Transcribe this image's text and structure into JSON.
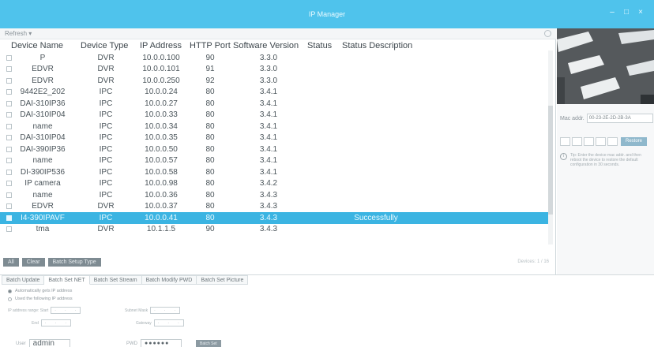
{
  "window": {
    "title": "IP Manager"
  },
  "toolbar": {
    "refresh": "Refresh ▾"
  },
  "table": {
    "headers": [
      "Device Name",
      "Device Type",
      "IP Address",
      "HTTP Port",
      "Software Version",
      "Status",
      "Status Description"
    ],
    "rows": [
      {
        "name": "P",
        "type": "DVR",
        "ip": "10.0.0.100",
        "port": "90",
        "version": "3.3.0",
        "status": "",
        "desc": "",
        "selected": false
      },
      {
        "name": "EDVR",
        "type": "DVR",
        "ip": "10.0.0.101",
        "port": "91",
        "version": "3.3.0",
        "status": "",
        "desc": "",
        "selected": false
      },
      {
        "name": "EDVR",
        "type": "DVR",
        "ip": "10.0.0.250",
        "port": "92",
        "version": "3.3.0",
        "status": "",
        "desc": "",
        "selected": false
      },
      {
        "name": "9442E2_202",
        "type": "IPC",
        "ip": "10.0.0.24",
        "port": "80",
        "version": "3.4.1",
        "status": "",
        "desc": "",
        "selected": false
      },
      {
        "name": "DAI-310IP36",
        "type": "IPC",
        "ip": "10.0.0.27",
        "port": "80",
        "version": "3.4.1",
        "status": "",
        "desc": "",
        "selected": false
      },
      {
        "name": "DAI-310IP04",
        "type": "IPC",
        "ip": "10.0.0.33",
        "port": "80",
        "version": "3.4.1",
        "status": "",
        "desc": "",
        "selected": false
      },
      {
        "name": "name",
        "type": "IPC",
        "ip": "10.0.0.34",
        "port": "80",
        "version": "3.4.1",
        "status": "",
        "desc": "",
        "selected": false
      },
      {
        "name": "DAI-310IP04",
        "type": "IPC",
        "ip": "10.0.0.35",
        "port": "80",
        "version": "3.4.1",
        "status": "",
        "desc": "",
        "selected": false
      },
      {
        "name": "DAI-390IP36",
        "type": "IPC",
        "ip": "10.0.0.50",
        "port": "80",
        "version": "3.4.1",
        "status": "",
        "desc": "",
        "selected": false
      },
      {
        "name": "name",
        "type": "IPC",
        "ip": "10.0.0.57",
        "port": "80",
        "version": "3.4.1",
        "status": "",
        "desc": "",
        "selected": false
      },
      {
        "name": "DI-390IP536",
        "type": "IPC",
        "ip": "10.0.0.58",
        "port": "80",
        "version": "3.4.1",
        "status": "",
        "desc": "",
        "selected": false
      },
      {
        "name": "IP camera",
        "type": "IPC",
        "ip": "10.0.0.98",
        "port": "80",
        "version": "3.4.2",
        "status": "",
        "desc": "",
        "selected": false
      },
      {
        "name": "name",
        "type": "IPC",
        "ip": "10.0.0.36",
        "port": "80",
        "version": "3.4.3",
        "status": "",
        "desc": "",
        "selected": false
      },
      {
        "name": "EDVR",
        "type": "DVR",
        "ip": "10.0.0.37",
        "port": "80",
        "version": "3.4.3",
        "status": "",
        "desc": "",
        "selected": false
      },
      {
        "name": "I4-390IPAVF",
        "type": "IPC",
        "ip": "10.0.0.41",
        "port": "80",
        "version": "3.4.3",
        "status": "",
        "desc": "Successfully",
        "selected": true
      },
      {
        "name": "tma",
        "type": "DVR",
        "ip": "10.1.1.5",
        "port": "90",
        "version": "3.4.3",
        "status": "",
        "desc": "",
        "selected": false
      }
    ]
  },
  "actions": {
    "all": "All",
    "clear": "Clear",
    "batch_setup": "Batch Setup Type"
  },
  "pagination": {
    "info": "Devices: 1 / 16"
  },
  "side": {
    "mac_label": "Mac addr.",
    "mac_value": "00-23-2E-2D-2B-3A",
    "restore": "Restore",
    "tip": "Tip: Enter the device mac addr. and then reboot the device to restore the default configuration in 30 seconds."
  },
  "tabs": [
    "Batch Update",
    "Batch Set NET",
    "Batch Set Stream",
    "Batch Modify PWD",
    "Batch Set Picture"
  ],
  "active_tab": 1,
  "net": {
    "auto_ip": "Automatically gets IP address",
    "use_following": "Used the following IP address",
    "start_ip_label": "IP address range: Start",
    "end_label": "End",
    "subnet_label": "Subnet Mask",
    "gateway_label": "Gateway",
    "ip_dots": ". . .",
    "user_label": "User",
    "user_value": "admin",
    "pwd_label": "PWD",
    "pwd_value": "●●●●●●",
    "batch_set": "Batch Set"
  }
}
